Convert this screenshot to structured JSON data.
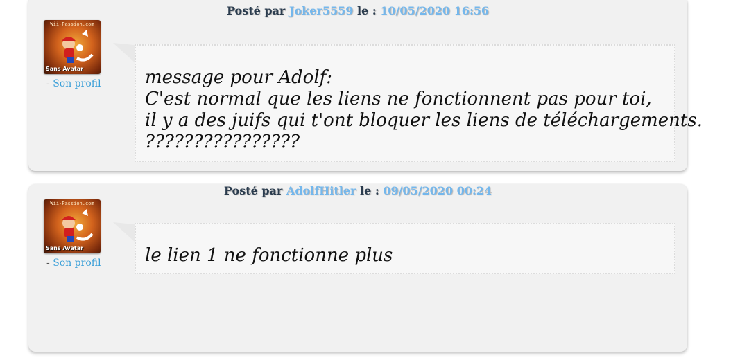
{
  "posts": [
    {
      "header": {
        "posted_by_label": "Posté par",
        "username": "Joker5559",
        "date_label": "le :",
        "date": "10/05/2020 16:56"
      },
      "avatar": {
        "site_label": "Wii-Passion.com",
        "tag": "Sans Avatar",
        "icon": "mario-avatar-icon"
      },
      "profile": {
        "prefix": "-",
        "link": "Son profil"
      },
      "message_lines": [
        "message pour Adolf:",
        "C'est normal que les liens ne fonctionnent pas pour toi,",
        "il y a des juifs qui t'ont bloquer les liens de téléchargements.",
        "????????????????"
      ]
    },
    {
      "header": {
        "posted_by_label": "Posté par",
        "username": "AdolfHitler",
        "date_label": "le :",
        "date": "09/05/2020 00:24"
      },
      "avatar": {
        "site_label": "Wii-Passion.com",
        "tag": "Sans Avatar",
        "icon": "mario-avatar-icon"
      },
      "profile": {
        "prefix": "-",
        "link": "Son profil"
      },
      "message_lines": [
        "le lien 1 ne fonctionne plus"
      ]
    }
  ],
  "colors": {
    "username": "#74b7ec",
    "header_text": "#2b3c4e",
    "profile_link": "#3a9fd8",
    "post_background": "#f1f1f1"
  }
}
